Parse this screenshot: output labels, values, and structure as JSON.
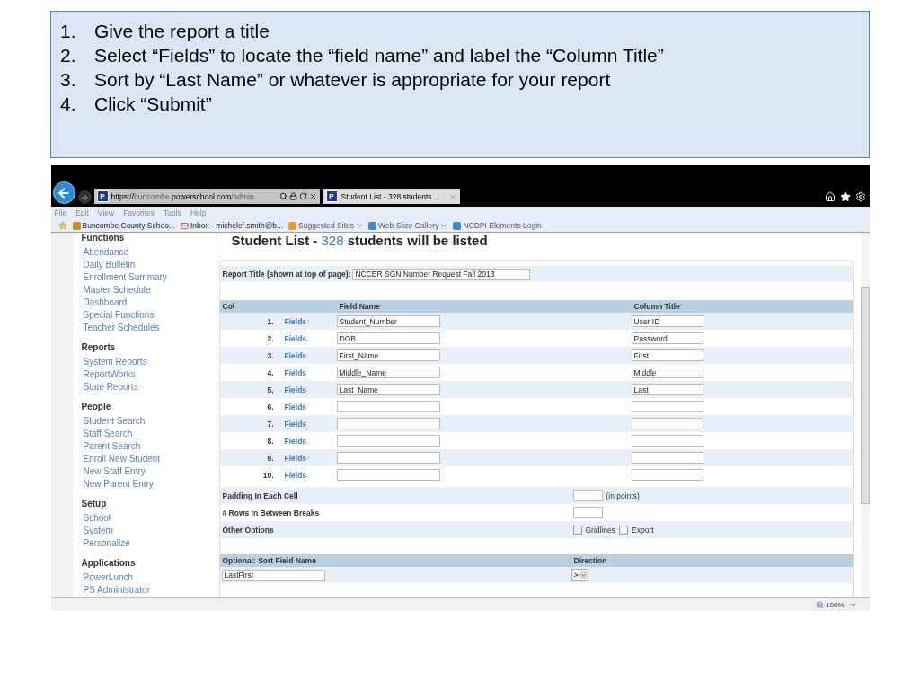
{
  "instructions": [
    {
      "number": "1.",
      "text": "Give the report a title"
    },
    {
      "number": "2.",
      "text": "Select “Fields” to locate the “field name” and label the “Column Title”"
    },
    {
      "number": "3.",
      "text": "Sort by “Last Name” or whatever is appropriate for your report"
    },
    {
      "number": "4.",
      "text": "Click “Submit”"
    }
  ],
  "browser": {
    "site_icon": "P",
    "address": [
      {
        "text": "https://",
        "dim": false
      },
      {
        "text": "buncombe.",
        "dim": true
      },
      {
        "text": "powerschool.com",
        "dim": false
      },
      {
        "text": "/admin",
        "dim": true
      }
    ],
    "tab": {
      "icon": "P",
      "title": "Student List - 328 students ...",
      "selected": true
    },
    "menu": [
      "File",
      "Edit",
      "View",
      "Favorites",
      "Tools",
      "Help"
    ],
    "favorites": [
      {
        "label": "Buncombe County Schoo...",
        "kind": "school",
        "dropdown": false
      },
      {
        "label": "Inbox - michelef.smith@b...",
        "kind": "mail",
        "dropdown": false
      },
      {
        "label": "Suggested Sites",
        "kind": "suggested",
        "dropdown": true
      },
      {
        "label": "Web Slice Gallery",
        "kind": "web",
        "dropdown": true
      },
      {
        "label": "NCDPI Elements Login",
        "kind": "web",
        "dropdown": false
      }
    ],
    "zoom": "100%"
  },
  "sidebar": [
    {
      "title": "Functions",
      "items": [
        "Attendance",
        "Daily Bulletin",
        "Enrollment Summary",
        "Master Schedule",
        "Dashboard",
        "Special Functions",
        "Teacher Schedules"
      ]
    },
    {
      "title": "Reports",
      "items": [
        "System Reports",
        "ReportWorks",
        "State Reports"
      ]
    },
    {
      "title": "People",
      "items": [
        "Student Search",
        "Staff Search",
        "Parent Search",
        "Enroll New Student",
        "New Staff Entry",
        "New Parent Entry"
      ]
    },
    {
      "title": "Setup",
      "items": [
        "School",
        "System",
        "Personalize"
      ]
    },
    {
      "title": "Applications",
      "items": [
        "PowerLunch",
        "PS Administrator"
      ]
    }
  ],
  "page": {
    "title": [
      {
        "text": "Student List - ",
        "highlight": false
      },
      {
        "text": "328",
        "highlight": true
      },
      {
        "text": " students will be listed",
        "highlight": false
      }
    ],
    "report_title": {
      "label": "Report Title (shown at top of page):",
      "value": "NCCER SGN Number Request Fall 2013"
    },
    "columns": {
      "col": "Col",
      "field_name": "Field Name",
      "column_title": "Column Title"
    },
    "rows": [
      {
        "number": "1.",
        "link": "Fields",
        "field_name": "Student_Number",
        "column_title": "User ID"
      },
      {
        "number": "2.",
        "link": "Fields",
        "field_name": "DOB",
        "column_title": "Password"
      },
      {
        "number": "3.",
        "link": "Fields",
        "field_name": "First_Name",
        "column_title": "First"
      },
      {
        "number": "4.",
        "link": "Fields",
        "field_name": "Middle_Name",
        "column_title": "Middle"
      },
      {
        "number": "5.",
        "link": "Fields",
        "field_name": "Last_Name",
        "column_title": "Last"
      },
      {
        "number": "6.",
        "link": "Fields"
      },
      {
        "number": "7.",
        "link": "Fields"
      },
      {
        "number": "8.",
        "link": "Fields"
      },
      {
        "number": "9.",
        "link": "Fields"
      },
      {
        "number": "10.",
        "link": "Fields"
      }
    ],
    "padding": {
      "label": "Padding In Each Cell",
      "suffix": "(in points)"
    },
    "rows_between_breaks": {
      "label": "# Rows In Between Breaks"
    },
    "other_options": {
      "label": "Other Options",
      "checkboxes": [
        {
          "label": "Gridlines",
          "checked": false
        },
        {
          "label": "Export",
          "checked": false
        }
      ]
    },
    "sort": {
      "label": "Optional: Sort Field Name",
      "value": "LastFirst",
      "direction_label": "Direction",
      "direction": ">"
    }
  }
}
